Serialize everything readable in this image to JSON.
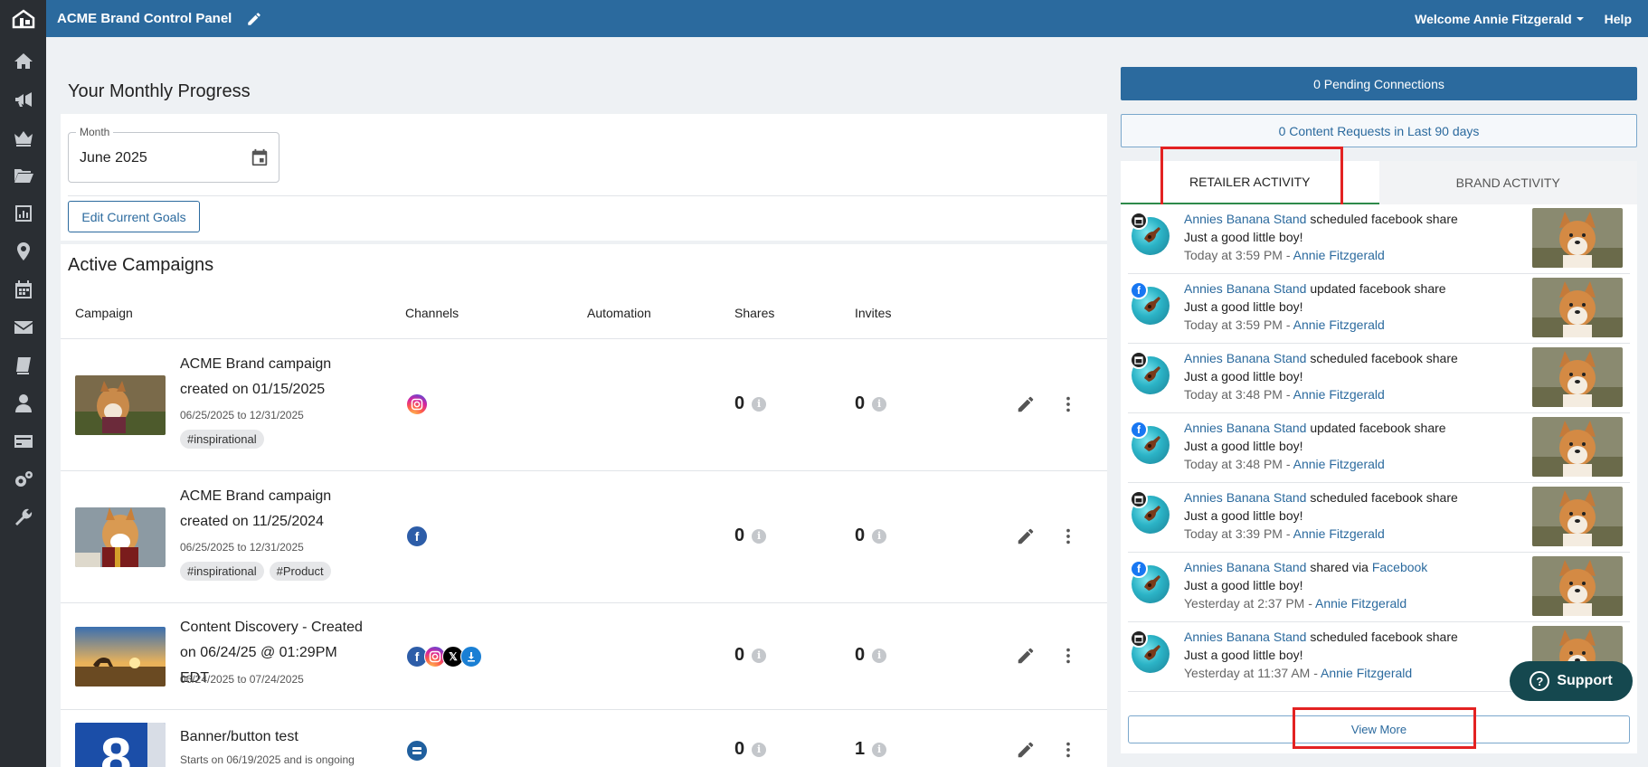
{
  "header": {
    "title": "ACME Brand Control Panel",
    "welcome": "Welcome Annie Fitzgerald",
    "help": "Help"
  },
  "progress": {
    "title": "Your Monthly Progress",
    "month_label": "Month",
    "month_value": "June 2025",
    "edit_goals": "Edit Current Goals"
  },
  "campaigns": {
    "title": "Active Campaigns",
    "columns": [
      "Campaign",
      "Channels",
      "Automation",
      "Shares",
      "Invites"
    ],
    "rows": [
      {
        "name": "ACME Brand campaign created on 01/15/2025",
        "dates": "06/25/2025 to 12/31/2025",
        "tags": [
          "#inspirational"
        ],
        "channels": [
          "instagram"
        ],
        "shares": "0",
        "invites": "0"
      },
      {
        "name": "ACME Brand campaign created on 11/25/2024",
        "dates": "06/25/2025 to 12/31/2025",
        "tags": [
          "#inspirational",
          "#Product"
        ],
        "channels": [
          "facebook"
        ],
        "shares": "0",
        "invites": "0"
      },
      {
        "name": "Content Discovery - Created on 06/24/25 @ 01:29PM EDT",
        "dates": "06/24/2025 to 07/24/2025",
        "tags": [],
        "channels": [
          "facebook",
          "instagram",
          "x",
          "download"
        ],
        "shares": "0",
        "invites": "0"
      },
      {
        "name": "Banner/button test",
        "dates": "Starts on 06/19/2025 and is ongoing",
        "tags": [],
        "channels": [
          "banner"
        ],
        "shares": "0",
        "invites": "1"
      }
    ]
  },
  "right": {
    "pending": "0 Pending Connections",
    "content_requests": "0 Content Requests in Last 90 days",
    "tabs": [
      "RETAILER ACTIVITY",
      "BRAND ACTIVITY"
    ],
    "feed": [
      {
        "actor": "Annies Banana Stand",
        "action": "scheduled facebook share",
        "badge": "sched",
        "caption": "Just a good little boy!",
        "time": "Today at 3:59 PM - ",
        "user": "Annie Fitzgerald"
      },
      {
        "actor": "Annies Banana Stand",
        "action": "updated facebook share",
        "badge": "fb",
        "caption": "Just a good little boy!",
        "time": "Today at 3:59 PM - ",
        "user": "Annie Fitzgerald"
      },
      {
        "actor": "Annies Banana Stand",
        "action": "scheduled facebook share",
        "badge": "sched",
        "caption": "Just a good little boy!",
        "time": "Today at 3:48 PM - ",
        "user": "Annie Fitzgerald"
      },
      {
        "actor": "Annies Banana Stand",
        "action": "updated facebook share",
        "badge": "fb",
        "caption": "Just a good little boy!",
        "time": "Today at 3:48 PM - ",
        "user": "Annie Fitzgerald"
      },
      {
        "actor": "Annies Banana Stand",
        "action": "scheduled facebook share",
        "badge": "sched",
        "caption": "Just a good little boy!",
        "time": "Today at 3:39 PM - ",
        "user": "Annie Fitzgerald"
      },
      {
        "actor": "Annies Banana Stand",
        "action": "shared via",
        "action_link": "Facebook",
        "badge": "fb",
        "caption": "Just a good little boy!",
        "time": "Yesterday at 2:37 PM - ",
        "user": "Annie Fitzgerald"
      },
      {
        "actor": "Annies Banana Stand",
        "action": "scheduled facebook share",
        "badge": "sched",
        "caption": "Just a good little boy!",
        "time": "Yesterday at 11:37 AM - ",
        "user": "Annie Fitzgerald"
      }
    ],
    "view_more": "View More"
  },
  "support": "Support",
  "colors": {
    "brand_blue": "#2b6a9e",
    "sidebar": "#2a2e33",
    "active_tab_underline": "#2e8a4a",
    "highlight_red": "#e32222",
    "support_bg": "#15484f"
  },
  "sidebar_icons": [
    "home-icon",
    "megaphone-icon",
    "crown-icon",
    "folder-icon",
    "bar-chart-icon",
    "location-pin-icon",
    "calendar-icon",
    "envelope-icon",
    "book-icon",
    "user-icon",
    "credit-card-icon",
    "gears-icon",
    "wrench-icon"
  ]
}
